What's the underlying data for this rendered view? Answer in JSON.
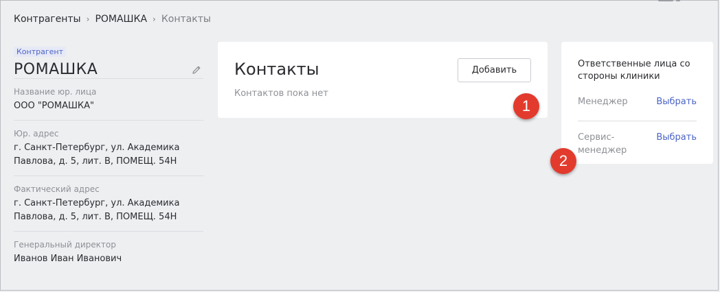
{
  "breadcrumb": {
    "items": [
      "Контрагенты",
      "РОМАШКА",
      "Контакты"
    ],
    "separator": "›"
  },
  "counterparty": {
    "tag": "Контрагент",
    "name": "РОМАШКА",
    "fields": [
      {
        "label": "Название юр. лица",
        "value": "ООО \"РОМАШКА\""
      },
      {
        "label": "Юр. адрес",
        "value": "г. Санкт-Петербург, ул. Академика Павлова, д. 5, лит. В, ПОМЕЩ. 54Н"
      },
      {
        "label": "Фактический адрес",
        "value": "г. Санкт-Петербург, ул. Академика Павлова, д. 5, лит. В, ПОМЕЩ. 54Н"
      },
      {
        "label": "Генеральный директор",
        "value": "Иванов Иван Иванович"
      }
    ]
  },
  "contacts": {
    "title": "Контакты",
    "empty_text": "Контактов пока нет",
    "add_label": "Добавить"
  },
  "responsible": {
    "title": "Ответственные лица со стороны клиники",
    "roles": [
      {
        "label": "Менеджер",
        "action": "Выбрать"
      },
      {
        "label": "Сервис-менеджер",
        "action": "Выбрать"
      }
    ]
  },
  "markers": [
    "1",
    "2"
  ],
  "colors": {
    "background": "#eeeff1",
    "accent": "#4b63c6",
    "marker": "#e23b2e"
  }
}
